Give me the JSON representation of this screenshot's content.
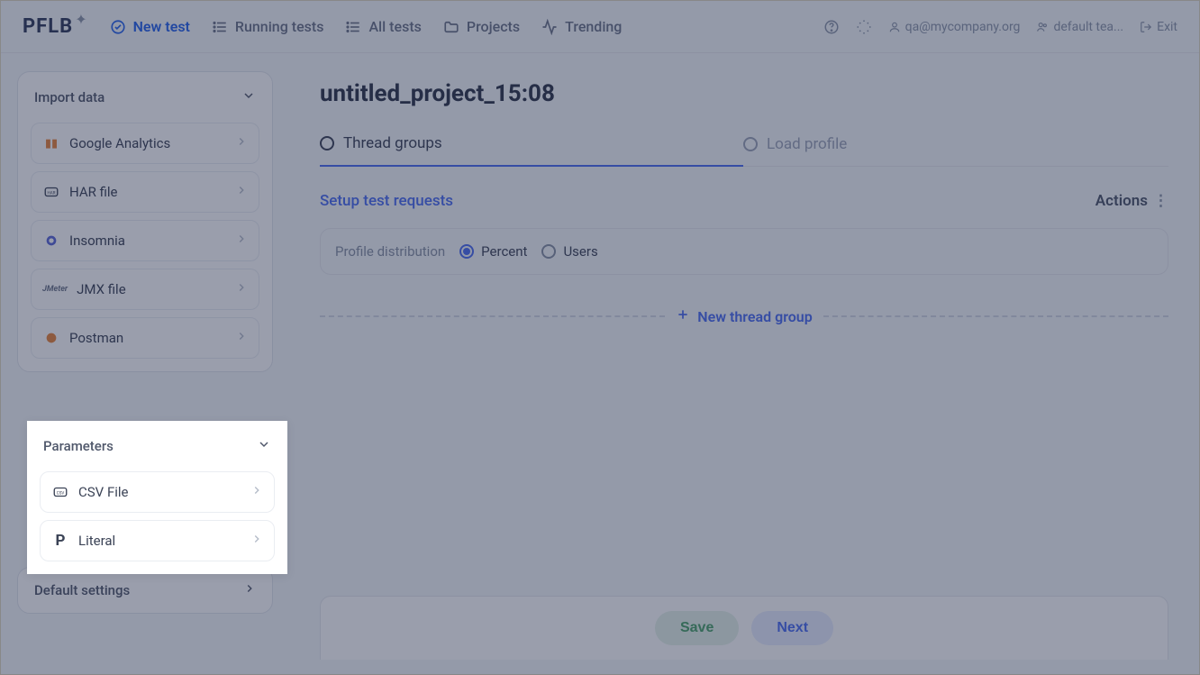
{
  "brand": "PFLB",
  "nav": {
    "new_test": "New test",
    "running_tests": "Running tests",
    "all_tests": "All tests",
    "projects": "Projects",
    "trending": "Trending"
  },
  "topbar": {
    "user_email": "qa@mycompany.org",
    "team": "default tea...",
    "exit": "Exit"
  },
  "sidebar": {
    "import_data": {
      "title": "Import data",
      "items": [
        {
          "label": "Google Analytics"
        },
        {
          "label": "HAR file"
        },
        {
          "label": "Insomnia"
        },
        {
          "label": "JMX file",
          "badge": "JMeter"
        },
        {
          "label": "Postman"
        }
      ]
    },
    "parameters": {
      "title": "Parameters",
      "items": [
        {
          "label": "CSV File"
        },
        {
          "label": "Literal"
        }
      ]
    },
    "default_settings": "Default settings"
  },
  "main": {
    "title": "untitled_project_15:08",
    "tabs": {
      "thread_groups": "Thread groups",
      "load_profile": "Load profile"
    },
    "setup_title": "Setup test requests",
    "actions_label": "Actions",
    "dist": {
      "label": "Profile distribution",
      "percent": "Percent",
      "users": "Users"
    },
    "new_thread_group": "New thread group",
    "save": "Save",
    "next": "Next"
  }
}
